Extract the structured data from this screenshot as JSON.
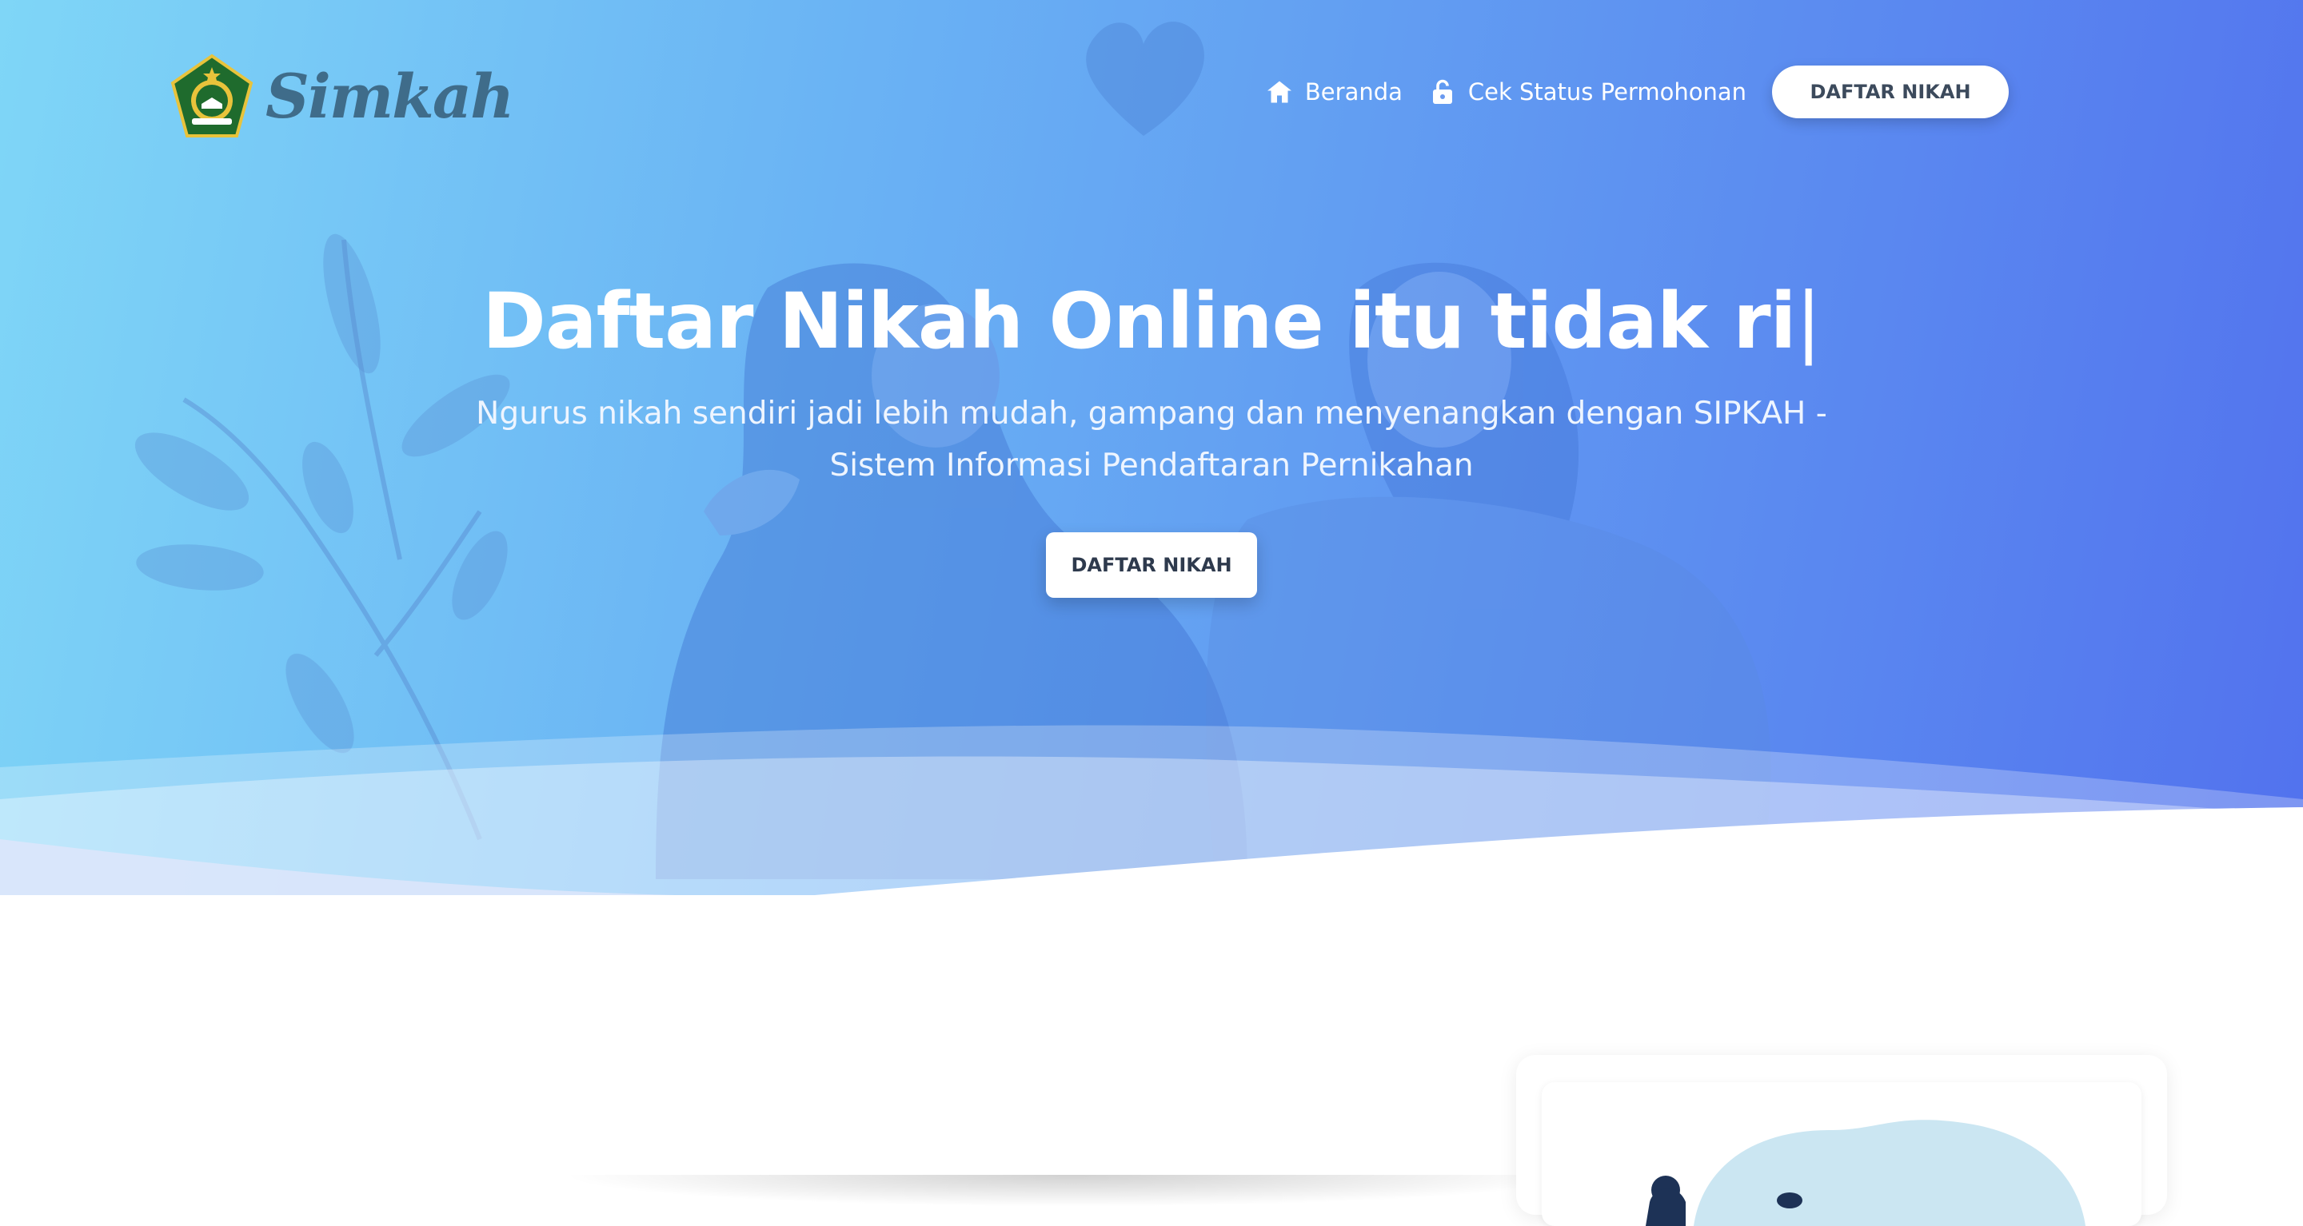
{
  "brand": {
    "name": "Simkah"
  },
  "nav": {
    "home_label": "Beranda",
    "status_label": "Cek Status Permohonan",
    "register_label": "DAFTAR NIKAH"
  },
  "hero": {
    "title": "Daftar Nikah Online itu tidak ri",
    "cursor": "|",
    "subtitle": "Ngurus nikah sendiri jadi lebih mudah, gampang dan menyenangkan dengan SIPKAH - Sistem Informasi Pendaftaran Pernikahan",
    "cta_label": "DAFTAR NIKAH"
  },
  "icons": {
    "home": "home-icon",
    "status": "unlock-icon",
    "logo": "kemenag-emblem"
  },
  "colors": {
    "gradient_start": "#7fd6f7",
    "gradient_end": "#5272ee",
    "button_text": "#3c4a5c",
    "logo_text": "#3f6c8a"
  }
}
